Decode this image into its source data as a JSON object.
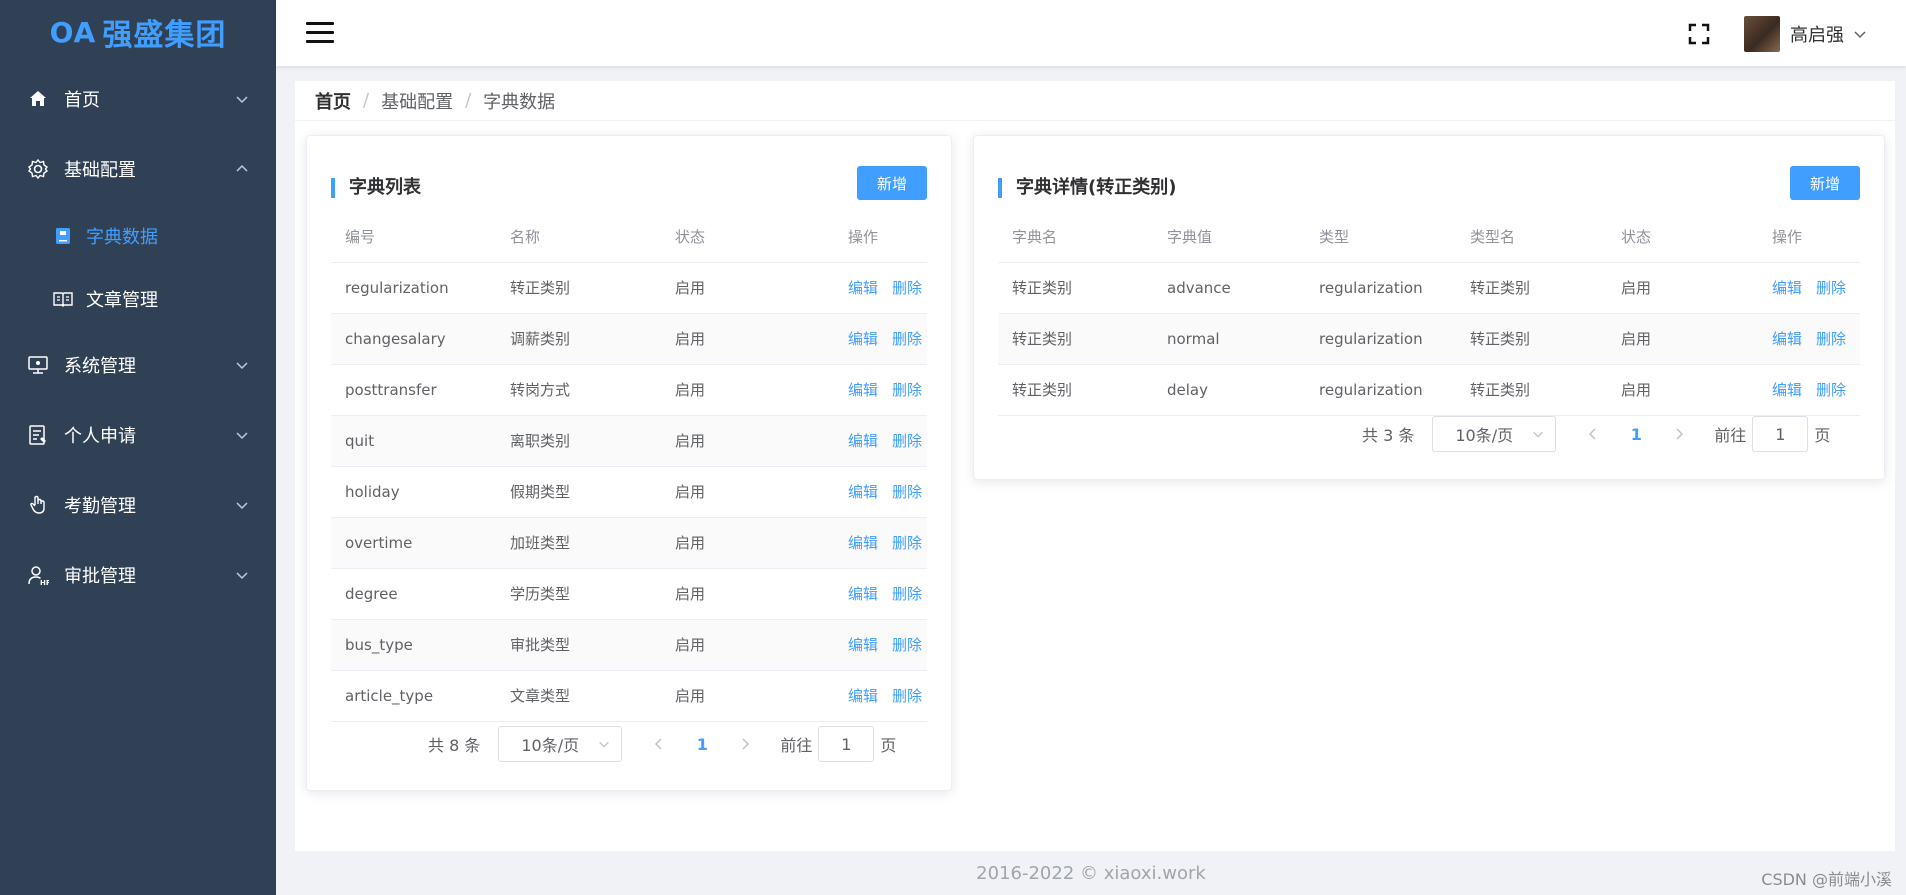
{
  "brand": {
    "logo_text": "强盛集团",
    "logo_mark": "OA"
  },
  "sidebar": {
    "items": [
      {
        "label": "首页",
        "icon": "home-icon",
        "expanded": false
      },
      {
        "label": "基础配置",
        "icon": "gear-icon",
        "expanded": true,
        "children": [
          {
            "label": "字典数据",
            "icon": "book-icon",
            "active": true
          },
          {
            "label": "文章管理",
            "icon": "open-book-icon",
            "active": false
          }
        ]
      },
      {
        "label": "系统管理",
        "icon": "monitor-icon",
        "expanded": false
      },
      {
        "label": "个人申请",
        "icon": "form-icon",
        "expanded": false
      },
      {
        "label": "考勤管理",
        "icon": "hand-icon",
        "expanded": false
      },
      {
        "label": "审批管理",
        "icon": "user-hr-icon",
        "expanded": false
      }
    ]
  },
  "topbar": {
    "user_name": "高启强"
  },
  "breadcrumb": {
    "home": "首页",
    "level1": "基础配置",
    "level2": "字典数据"
  },
  "dict_list": {
    "title": "字典列表",
    "add_label": "新增",
    "columns": [
      "编号",
      "名称",
      "状态",
      "操作"
    ],
    "rows": [
      {
        "code": "regularization",
        "name": "转正类别",
        "status": "启用"
      },
      {
        "code": "changesalary",
        "name": "调薪类别",
        "status": "启用"
      },
      {
        "code": "posttransfer",
        "name": "转岗方式",
        "status": "启用"
      },
      {
        "code": "quit",
        "name": "离职类别",
        "status": "启用"
      },
      {
        "code": "holiday",
        "name": "假期类型",
        "status": "启用"
      },
      {
        "code": "overtime",
        "name": "加班类型",
        "status": "启用"
      },
      {
        "code": "degree",
        "name": "学历类型",
        "status": "启用"
      },
      {
        "code": "bus_type",
        "name": "审批类型",
        "status": "启用"
      },
      {
        "code": "article_type",
        "name": "文章类型",
        "status": "启用"
      }
    ],
    "edit_label": "编辑",
    "delete_label": "删除",
    "pager": {
      "total": "共 8 条",
      "page_size": "10条/页",
      "current": "1",
      "goto": "前往",
      "jump_value": "1",
      "page_unit": "页"
    }
  },
  "dict_detail": {
    "title": "字典详情(转正类别)",
    "add_label": "新增",
    "columns": [
      "字典名",
      "字典值",
      "类型",
      "类型名",
      "状态",
      "操作"
    ],
    "rows": [
      {
        "dict_name": "转正类别",
        "value": "advance",
        "type": "regularization",
        "type_name": "转正类别",
        "status": "启用"
      },
      {
        "dict_name": "转正类别",
        "value": "normal",
        "type": "regularization",
        "type_name": "转正类别",
        "status": "启用"
      },
      {
        "dict_name": "转正类别",
        "value": "delay",
        "type": "regularization",
        "type_name": "转正类别",
        "status": "启用"
      }
    ],
    "edit_label": "编辑",
    "delete_label": "删除",
    "pager": {
      "total": "共 3 条",
      "page_size": "10条/页",
      "current": "1",
      "goto": "前往",
      "jump_value": "1",
      "page_unit": "页"
    }
  },
  "footer": {
    "copyright": "2016-2022 © xiaoxi.work"
  },
  "watermark": "CSDN @前端小溪",
  "colors": {
    "sidebar_bg": "#304156",
    "accent": "#409eff"
  }
}
